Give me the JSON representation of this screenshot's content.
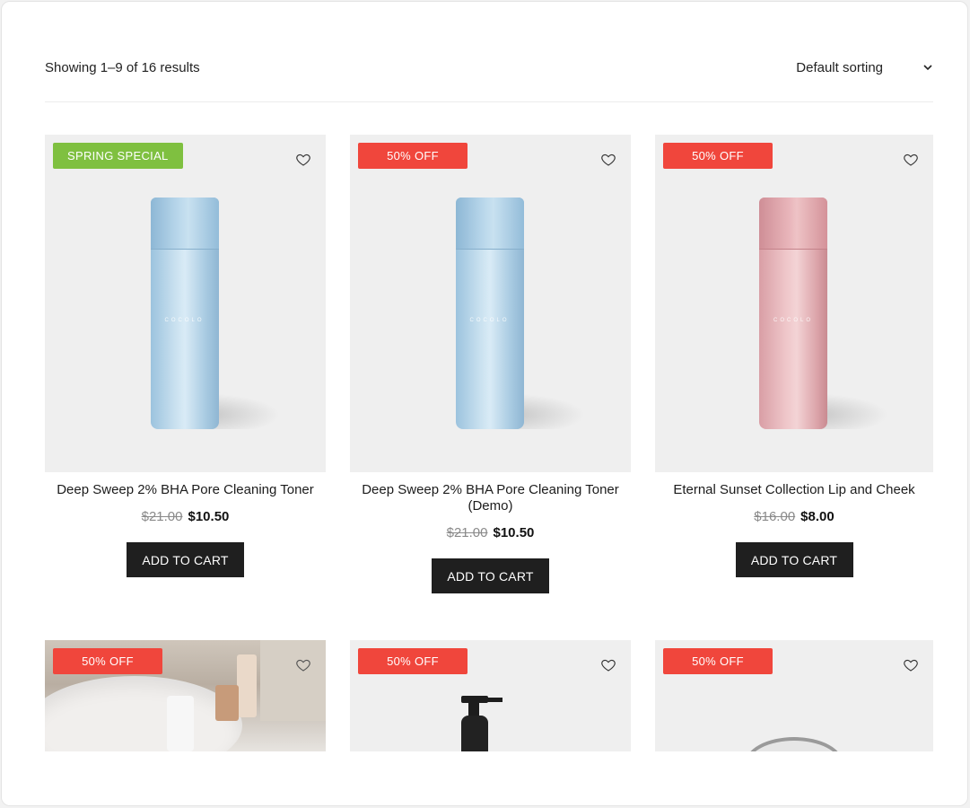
{
  "toolbar": {
    "result_count": "Showing 1–9 of 16 results",
    "sort_label": "Default sorting"
  },
  "products": [
    {
      "badge": "SPRING SPECIAL",
      "title": "Deep Sweep 2% BHA Pore Cleaning Toner",
      "old_price": "$21.00",
      "price": "$10.50",
      "button": "ADD TO CART",
      "brand": "COCOLO",
      "image": "blue-bottle"
    },
    {
      "badge": "50% OFF",
      "title": "Deep Sweep 2% BHA Pore Cleaning Toner (Demo)",
      "old_price": "$21.00",
      "price": "$10.50",
      "button": "ADD TO CART",
      "brand": "COCOLO",
      "image": "blue-bottle"
    },
    {
      "badge": "50% OFF",
      "title": "Eternal Sunset Collection Lip and Cheek",
      "old_price": "$16.00",
      "price": "$8.00",
      "button": "ADD TO CART",
      "brand": "COCOLO",
      "image": "pink-bottle"
    },
    {
      "badge": "50% OFF",
      "image": "bathroom-photo"
    },
    {
      "badge": "50% OFF",
      "image": "black-pump-bottle"
    },
    {
      "badge": "50% OFF",
      "image": "round-tin"
    }
  ],
  "colors": {
    "sale_badge": "#f0463c",
    "spring_badge": "#7fc040",
    "button_bg": "#1f1f1f"
  },
  "icons": {
    "wishlist": "heart-outline-icon",
    "sort": "chevron-down-icon"
  }
}
